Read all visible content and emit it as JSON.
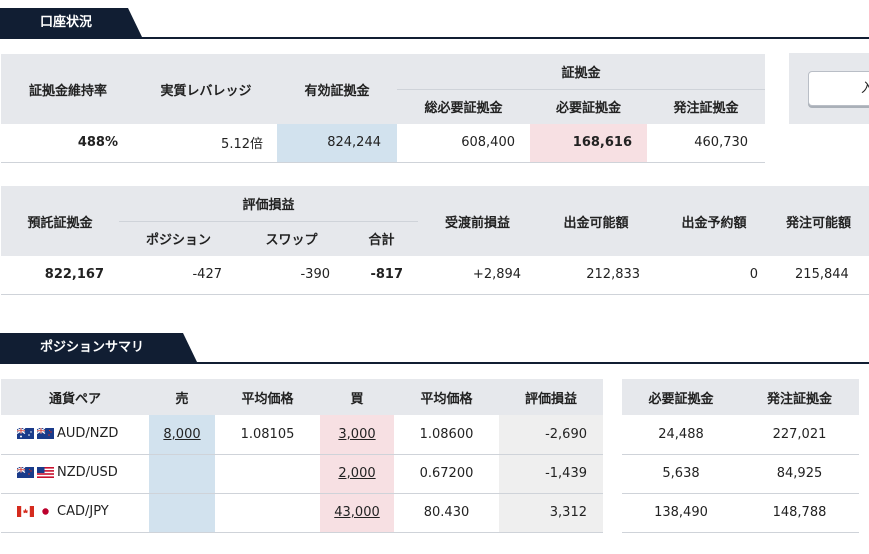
{
  "section1": {
    "title": "口座状況"
  },
  "account": {
    "headers": {
      "margin_ratio": "証拠金維持率",
      "leverage": "実質レバレッジ",
      "effective_margin": "有効証拠金",
      "margin_group": "証拠金",
      "total_required": "総必要証拠金",
      "required": "必要証拠金",
      "order_margin": "発注証拠金"
    },
    "values": {
      "margin_ratio": "488%",
      "leverage": "5.12倍",
      "effective_margin": "824,244",
      "total_required": "608,400",
      "required": "168,616",
      "order_margin": "460,730"
    }
  },
  "side_button": {
    "label": "入"
  },
  "balance": {
    "headers": {
      "deposit": "預託証拠金",
      "pl_group": "評価損益",
      "position": "ポジション",
      "swap": "スワップ",
      "total": "合計",
      "pre_settlement": "受渡前損益",
      "withdrawable": "出金可能額",
      "scheduled_withdrawal": "出金予約額",
      "orderable": "発注可能額"
    },
    "values": {
      "deposit": "822,167",
      "position": "-427",
      "swap": "-390",
      "total": "-817",
      "pre_settlement": "+2,894",
      "withdrawable": "212,833",
      "scheduled_withdrawal": "0",
      "orderable": "215,844"
    }
  },
  "section2": {
    "title": "ポジションサマリ"
  },
  "summary": {
    "headers": {
      "pair": "通貨ペア",
      "sell": "売",
      "sell_avg": "平均価格",
      "buy": "買",
      "buy_avg": "平均価格",
      "pl": "評価損益",
      "required": "必要証拠金",
      "order_margin": "発注証拠金"
    },
    "rows": [
      {
        "pair": "AUD/NZD",
        "flag": "aud",
        "sell": "8,000",
        "sell_avg": "1.08105",
        "buy": "3,000",
        "buy_avg": "1.08600",
        "pl": "-2,690",
        "required": "24,488",
        "order_margin": "227,021"
      },
      {
        "pair": "NZD/USD",
        "flag": "nzd",
        "sell": "",
        "sell_avg": "",
        "buy": "2,000",
        "buy_avg": "0.67200",
        "pl": "-1,439",
        "required": "5,638",
        "order_margin": "84,925"
      },
      {
        "pair": "CAD/JPY",
        "flag": "cad",
        "sell": "",
        "sell_avg": "",
        "buy": "43,000",
        "buy_avg": "80.430",
        "pl": "3,312",
        "required": "138,490",
        "order_margin": "148,788"
      }
    ]
  }
}
